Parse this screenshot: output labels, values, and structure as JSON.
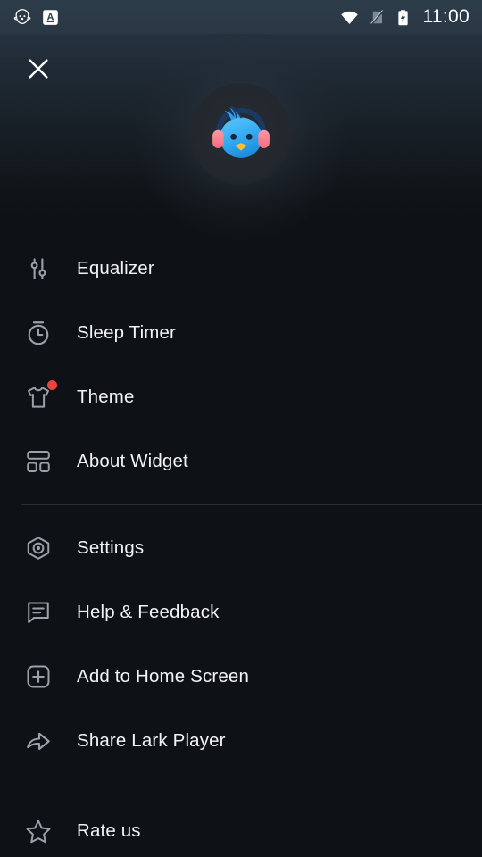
{
  "statusbar": {
    "time": "11:00",
    "left_icons": [
      {
        "name": "lark-player-notification-icon",
        "glyph": "bird-headphones"
      },
      {
        "name": "translate-app-icon",
        "glyph": "A"
      }
    ],
    "right_icons": [
      {
        "name": "wifi-icon",
        "glyph": "wifi"
      },
      {
        "name": "no-sim-icon",
        "glyph": "sim-slash"
      },
      {
        "name": "battery-charging-icon",
        "glyph": "battery-bolt"
      }
    ]
  },
  "header": {
    "close_label": "×",
    "close_icon": "close-icon",
    "logo_icon": "lark-player-logo",
    "logo_alt": "Lark Player"
  },
  "menu": {
    "groups": [
      {
        "items": [
          {
            "icon": "equalizer-icon",
            "label": "Equalizer",
            "badge": false
          },
          {
            "icon": "sleep-timer-icon",
            "label": "Sleep Timer",
            "badge": false
          },
          {
            "icon": "theme-shirt-icon",
            "label": "Theme",
            "badge": true
          },
          {
            "icon": "widget-icon",
            "label": "About Widget",
            "badge": false
          }
        ]
      },
      {
        "items": [
          {
            "icon": "settings-gear-icon",
            "label": "Settings",
            "badge": false
          },
          {
            "icon": "feedback-chat-icon",
            "label": "Help & Feedback",
            "badge": false
          },
          {
            "icon": "add-square-icon",
            "label": "Add to Home Screen",
            "badge": false
          },
          {
            "icon": "share-arrow-icon",
            "label": "Share Lark Player",
            "badge": false
          }
        ]
      },
      {
        "items": [
          {
            "icon": "star-icon",
            "label": "Rate us",
            "badge": false
          }
        ]
      }
    ]
  },
  "colors": {
    "background": "#0e1216",
    "statusbar": "#2d3c49",
    "text": "#f2f3f4",
    "icon": "#9aa1a8",
    "badge_red": "#e8453c",
    "logo_blue": "#3fb6f5",
    "logo_pink": "#f97f8e",
    "logo_beak": "#ffc22e",
    "divider": "#262d34"
  }
}
